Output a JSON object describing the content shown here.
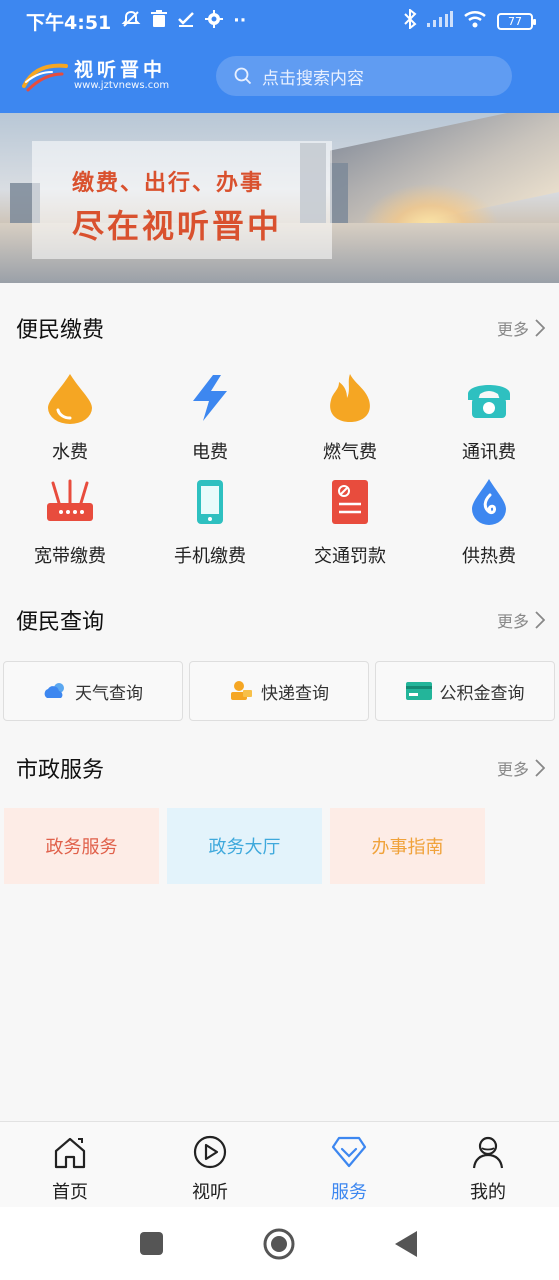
{
  "status_bar": {
    "time": "下午4:51",
    "icons": [
      "mute-icon",
      "trash-icon",
      "check-icon",
      "gear-icon",
      "more-dots-icon"
    ],
    "right_icons": [
      "bluetooth-icon",
      "signal-icon",
      "wifi-icon"
    ],
    "battery": "77"
  },
  "header": {
    "logo_name": "视听晋中",
    "logo_url": "www.jztvnews.com",
    "search_placeholder": "点击搜索内容"
  },
  "banner": {
    "line1": "缴费、出行、办事",
    "line2": "尽在视听晋中"
  },
  "payment": {
    "title": "便民缴费",
    "more": "更多",
    "items": [
      {
        "label": "水费",
        "icon": "water-drop-icon",
        "color": "#f5a623"
      },
      {
        "label": "电费",
        "icon": "lightning-icon",
        "color": "#3d87f0"
      },
      {
        "label": "燃气费",
        "icon": "flame-icon",
        "color": "#f5a623"
      },
      {
        "label": "通讯费",
        "icon": "telephone-icon",
        "color": "#2ec0c0"
      },
      {
        "label": "宽带缴费",
        "icon": "router-icon",
        "color": "#e84c3d"
      },
      {
        "label": "手机缴费",
        "icon": "mobile-phone-icon",
        "color": "#2ec0c0"
      },
      {
        "label": "交通罚款",
        "icon": "ticket-icon",
        "color": "#e84c3d"
      },
      {
        "label": "供热费",
        "icon": "heat-drop-icon",
        "color": "#3d87f0"
      }
    ]
  },
  "query": {
    "title": "便民查询",
    "more": "更多",
    "items": [
      {
        "label": "天气查询",
        "icon": "weather-cloud-icon"
      },
      {
        "label": "快递查询",
        "icon": "delivery-icon"
      },
      {
        "label": "公积金查询",
        "icon": "card-icon"
      }
    ]
  },
  "municipal": {
    "title": "市政服务",
    "more": "更多",
    "items": [
      {
        "label": "政务服务",
        "bg": "#fdece6",
        "color": "#e0604a"
      },
      {
        "label": "政务大厅",
        "bg": "#e3f3fb",
        "color": "#3fa9dc"
      },
      {
        "label": "办事指南",
        "bg": "#fdece6",
        "color": "#f0a23a"
      }
    ]
  },
  "bottom_nav": {
    "items": [
      {
        "label": "首页",
        "icon": "home-icon"
      },
      {
        "label": "视听",
        "icon": "play-icon"
      },
      {
        "label": "服务",
        "icon": "diamond-icon",
        "active": true
      },
      {
        "label": "我的",
        "icon": "user-icon"
      }
    ]
  },
  "colors": {
    "brand": "#3d87f0",
    "background": "#f7f7f7"
  }
}
